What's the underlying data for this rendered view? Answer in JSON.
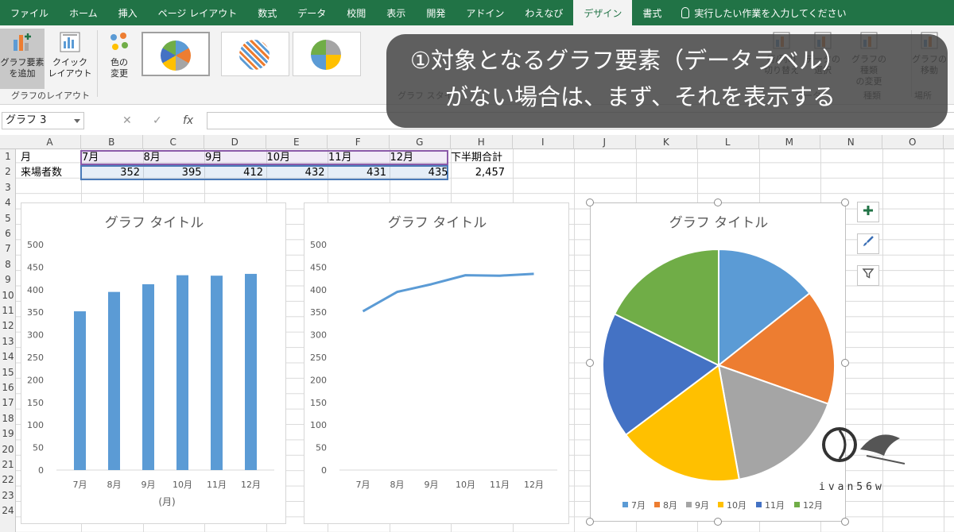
{
  "tabs": [
    {
      "label": "ファイル",
      "active": false
    },
    {
      "label": "ホーム",
      "active": false
    },
    {
      "label": "挿入",
      "active": false
    },
    {
      "label": "ページ レイアウト",
      "active": false
    },
    {
      "label": "数式",
      "active": false
    },
    {
      "label": "データ",
      "active": false
    },
    {
      "label": "校閲",
      "active": false
    },
    {
      "label": "表示",
      "active": false
    },
    {
      "label": "開発",
      "active": false
    },
    {
      "label": "アドイン",
      "active": false
    },
    {
      "label": "わえなび",
      "active": false
    },
    {
      "label": "デザイン",
      "active": true
    },
    {
      "label": "書式",
      "active": false
    }
  ],
  "tell_me": "実行したい作業を入力してください",
  "ribbon": {
    "add_element": {
      "line1": "グラフ要素",
      "line2": "を追加"
    },
    "quick_layout": {
      "line1": "クイック",
      "line2": "レイアウト"
    },
    "change_color": {
      "line1": "色の",
      "line2": "変更"
    },
    "group_layout": "グラフのレイアウト",
    "group_style_partial": "グラフ スタイ",
    "switch_row_col": {
      "line1": "行/列の",
      "line2": "切り替え"
    },
    "select_data": {
      "line1": "データの",
      "line2": "選択"
    },
    "change_type": {
      "line1": "グラフの種類",
      "line2": "の変更"
    },
    "move_chart": {
      "line1": "グラフの",
      "line2": "移動"
    },
    "group_data_partial": "データ",
    "group_type_partial": "種類",
    "group_location_partial": "場所"
  },
  "caption": {
    "line1": "①対象となるグラフ要素（データラベル）",
    "line2": "がない場合は、まず、それを表示する"
  },
  "namebox": "グラフ 3",
  "formula_icons": {
    "cancel": "✕",
    "enter": "✓",
    "fx": "fx"
  },
  "columns": [
    "A",
    "B",
    "C",
    "D",
    "E",
    "F",
    "G",
    "H",
    "I",
    "J",
    "K",
    "L",
    "M",
    "N",
    "O"
  ],
  "rows": [
    "1",
    "2",
    "3",
    "4",
    "5",
    "6",
    "7",
    "8",
    "9",
    "10",
    "11",
    "12",
    "13",
    "14",
    "15",
    "16",
    "17",
    "18",
    "19",
    "20",
    "21",
    "22",
    "23",
    "24"
  ],
  "sheet": {
    "a1": "月",
    "a2": "来場者数",
    "months": [
      "7月",
      "8月",
      "9月",
      "10月",
      "11月",
      "12月"
    ],
    "visitors": [
      "352",
      "395",
      "412",
      "432",
      "431",
      "435"
    ],
    "h1": "下半期合計",
    "h2": "2,457"
  },
  "colors": {
    "series_blue": "#5b9bd5",
    "pie": [
      "#5b9bd5",
      "#ed7d31",
      "#a5a5a5",
      "#ffc000",
      "#4472c4",
      "#70ad47"
    ],
    "excel_green": "#217346"
  },
  "chart_data": [
    {
      "type": "bar",
      "title": "グラフ タイトル",
      "categories": [
        "7月",
        "8月",
        "9月",
        "10月",
        "11月",
        "12月"
      ],
      "values": [
        352,
        395,
        412,
        432,
        431,
        435
      ],
      "xlabel": "(月)",
      "ylabel": "",
      "ylim": [
        0,
        500
      ],
      "yticks": [
        "0",
        "50",
        "100",
        "150",
        "200",
        "250",
        "300",
        "350",
        "400",
        "450",
        "500"
      ],
      "grid": false
    },
    {
      "type": "line",
      "title": "グラフ タイトル",
      "categories": [
        "7月",
        "8月",
        "9月",
        "10月",
        "11月",
        "12月"
      ],
      "values": [
        352,
        395,
        412,
        432,
        431,
        435
      ],
      "xlabel": "",
      "ylabel": "",
      "ylim": [
        0,
        500
      ],
      "yticks": [
        "0",
        "50",
        "100",
        "150",
        "200",
        "250",
        "300",
        "350",
        "400",
        "450",
        "500"
      ],
      "grid": false
    },
    {
      "type": "pie",
      "title": "グラフ タイトル",
      "categories": [
        "7月",
        "8月",
        "9月",
        "10月",
        "11月",
        "12月"
      ],
      "values": [
        352,
        395,
        412,
        432,
        431,
        435
      ],
      "legend": "bottom"
    }
  ]
}
